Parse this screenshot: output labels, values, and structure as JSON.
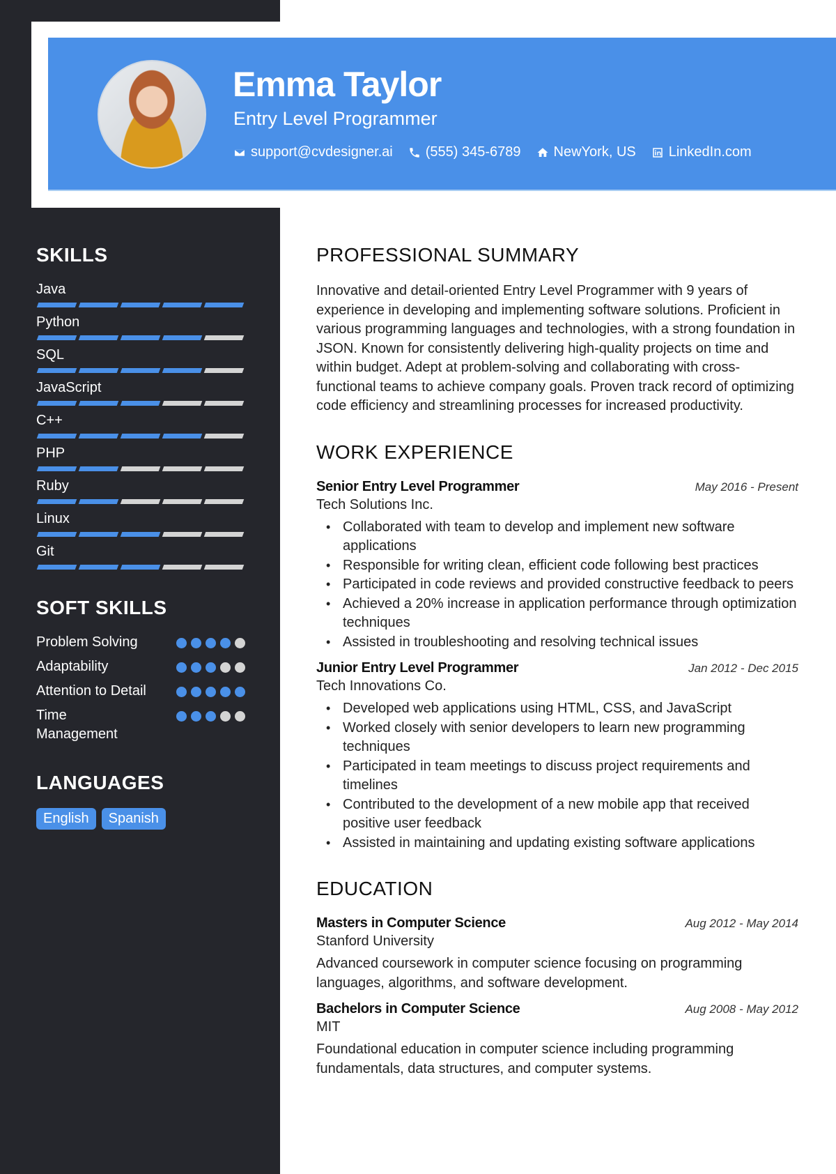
{
  "header": {
    "name": "Emma Taylor",
    "title": "Entry Level Programmer",
    "contacts": [
      {
        "icon": "envelope-icon",
        "text": "support@cvdesigner.ai"
      },
      {
        "icon": "phone-icon",
        "text": "(555) 345-6789"
      },
      {
        "icon": "home-icon",
        "text": "NewYork, US"
      },
      {
        "icon": "linkedin-icon",
        "text": "LinkedIn.com"
      }
    ]
  },
  "colors": {
    "accent": "#4a90e8",
    "sidebar": "#25262c",
    "inactive": "#d4d4d4"
  },
  "sidebar": {
    "skills_title": "SKILLS",
    "skills": [
      {
        "name": "Java",
        "level": 5,
        "max": 5
      },
      {
        "name": "Python",
        "level": 4,
        "max": 5
      },
      {
        "name": "SQL",
        "level": 4,
        "max": 5
      },
      {
        "name": "JavaScript",
        "level": 3,
        "max": 5
      },
      {
        "name": "C++",
        "level": 4,
        "max": 5
      },
      {
        "name": "PHP",
        "level": 2,
        "max": 5
      },
      {
        "name": "Ruby",
        "level": 2,
        "max": 5
      },
      {
        "name": "Linux",
        "level": 3,
        "max": 5
      },
      {
        "name": "Git",
        "level": 3,
        "max": 5
      }
    ],
    "soft_skills_title": "SOFT SKILLS",
    "soft_skills": [
      {
        "name": "Problem Solving",
        "level": 4,
        "max": 5
      },
      {
        "name": "Adaptability",
        "level": 3,
        "max": 5
      },
      {
        "name": "Attention to Detail",
        "level": 5,
        "max": 5
      },
      {
        "name": "Time Management",
        "level": 3,
        "max": 5
      }
    ],
    "languages_title": "LANGUAGES",
    "languages": [
      "English",
      "Spanish"
    ]
  },
  "main": {
    "summary_title": "PROFESSIONAL SUMMARY",
    "summary": "Innovative and detail-oriented Entry Level Programmer with 9 years of experience in developing and implementing software solutions. Proficient in various programming languages and technologies, with a strong foundation in JSON. Known for consistently delivering high-quality projects on time and within budget. Adept at problem-solving and collaborating with cross-functional teams to achieve company goals. Proven track record of optimizing code efficiency and streamlining processes for increased productivity.",
    "experience_title": "WORK EXPERIENCE",
    "experience": [
      {
        "role": "Senior Entry Level Programmer",
        "company": "Tech Solutions Inc.",
        "dates": "May 2016 - Present",
        "bullets": [
          "Collaborated with team to develop and implement new software applications",
          "Responsible for writing clean, efficient code following best practices",
          "Participated in code reviews and provided constructive feedback to peers",
          "Achieved a 20% increase in application performance through optimization techniques",
          "Assisted in troubleshooting and resolving technical issues"
        ]
      },
      {
        "role": "Junior Entry Level Programmer",
        "company": "Tech Innovations Co.",
        "dates": "Jan 2012 - Dec 2015",
        "bullets": [
          "Developed web applications using HTML, CSS, and JavaScript",
          "Worked closely with senior developers to learn new programming techniques",
          "Participated in team meetings to discuss project requirements and timelines",
          "Contributed to the development of a new mobile app that received positive user feedback",
          "Assisted in maintaining and updating existing software applications"
        ]
      }
    ],
    "education_title": "EDUCATION",
    "education": [
      {
        "degree": "Masters in Computer Science",
        "school": "Stanford University",
        "dates": "Aug 2012 - May 2014",
        "description": "Advanced coursework in computer science focusing on programming languages, algorithms, and software development."
      },
      {
        "degree": "Bachelors in Computer Science",
        "school": "MIT",
        "dates": "Aug 2008 - May 2012",
        "description": "Foundational education in computer science including programming fundamentals, data structures, and computer systems."
      }
    ]
  }
}
